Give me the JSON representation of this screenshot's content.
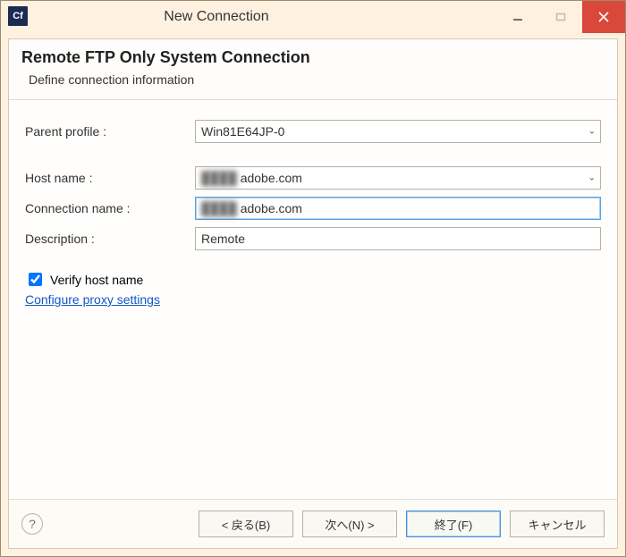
{
  "window": {
    "app_icon_text": "Cf",
    "title": "New Connection"
  },
  "header": {
    "title": "Remote FTP Only System Connection",
    "subtitle": "Define connection information"
  },
  "form": {
    "parent_profile_label": "Parent profile :",
    "parent_profile_value": "Win81E64JP-0",
    "host_name_label": "Host name :",
    "host_name_obscured": "████",
    "host_name_suffix": "adobe.com",
    "connection_name_label": "Connection name :",
    "connection_name_obscured": "████",
    "connection_name_suffix": "adobe.com",
    "description_label": "Description :",
    "description_value": "Remote",
    "verify_host_label": "Verify host name",
    "verify_host_checked": true,
    "proxy_link": "Configure proxy settings"
  },
  "footer": {
    "help_glyph": "?",
    "back": "< 戻る(B)",
    "next": "次へ(N) >",
    "finish": "終了(F)",
    "cancel": "キャンセル"
  }
}
